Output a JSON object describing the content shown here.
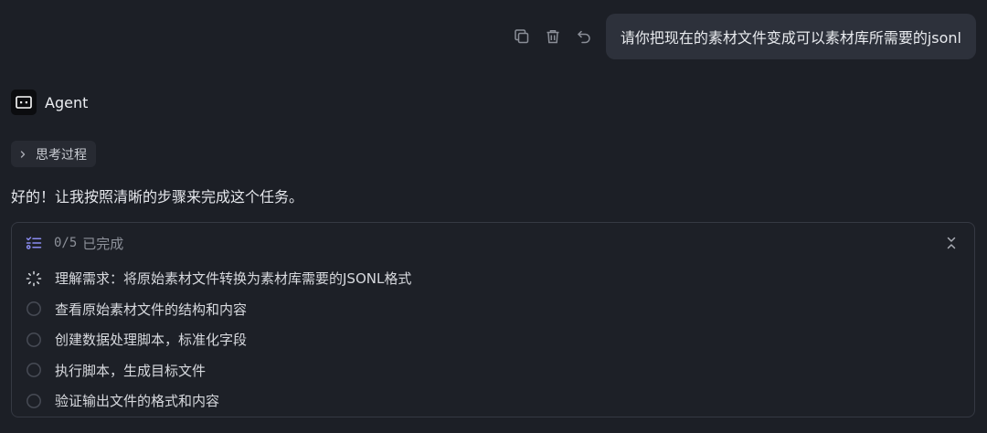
{
  "user_message": {
    "text": "请你把现在的素材文件变成可以素材库所需要的jsonl",
    "actions": [
      {
        "name": "copy",
        "icon": "copy-icon"
      },
      {
        "name": "delete",
        "icon": "trash-icon"
      },
      {
        "name": "undo",
        "icon": "undo-icon"
      }
    ]
  },
  "agent": {
    "name": "Agent",
    "icon": "agent-icon"
  },
  "thinking": {
    "label": "思考过程",
    "icon": "chevron-right-icon"
  },
  "intro_text": "好的！让我按照清晰的步骤来完成这个任务。",
  "task_list": {
    "count": "0/5",
    "status": "已完成",
    "icon": "checklist-icon",
    "collapse_icon": "collapse-icon",
    "items": [
      {
        "label": "理解需求：将原始素材文件转换为素材库需要的JSONL格式",
        "state": "in_progress"
      },
      {
        "label": "查看原始素材文件的结构和内容",
        "state": "pending"
      },
      {
        "label": "创建数据处理脚本，标准化字段",
        "state": "pending"
      },
      {
        "label": "执行脚本，生成目标文件",
        "state": "pending"
      },
      {
        "label": "验证输出文件的格式和内容",
        "state": "pending"
      }
    ]
  },
  "colors": {
    "background": "#1c1f26",
    "bubble": "#2d313b",
    "accent_icon": "#8a8cf0",
    "muted": "#8d919a"
  }
}
